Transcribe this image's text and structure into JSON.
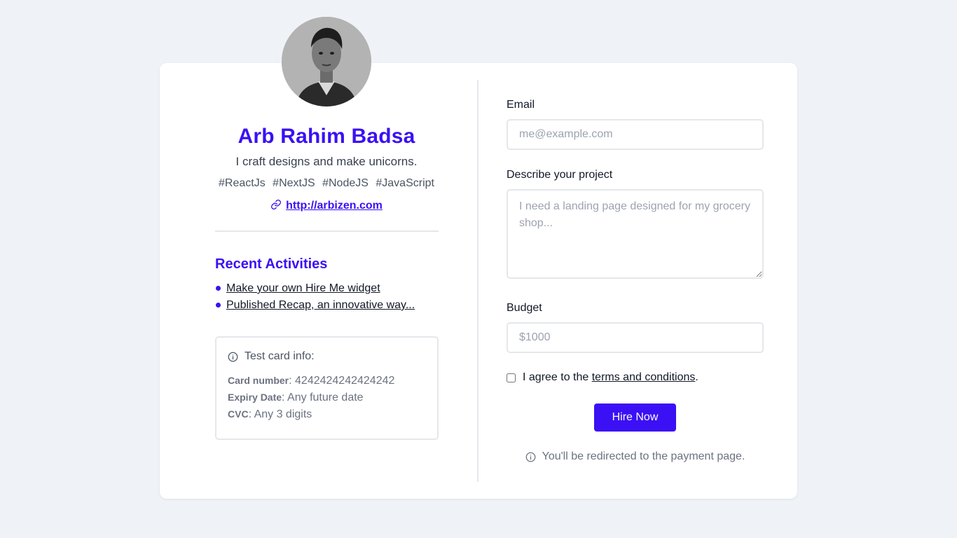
{
  "profile": {
    "name": "Arb Rahim Badsa",
    "tagline": "I craft designs and make unicorns.",
    "tags": [
      "#ReactJs",
      "#NextJS",
      "#NodeJS",
      "#JavaScript"
    ],
    "website": "http://arbizen.com",
    "avatar_icon": "profile-photo"
  },
  "recent": {
    "title": "Recent Activities",
    "items": [
      "Make your own Hire Me widget",
      "Published Recap, an innovative way..."
    ]
  },
  "test_card": {
    "heading": "Test card info:",
    "card_number_label": "Card number",
    "card_number_value": ": 4242424242424242",
    "expiry_label": "Expiry Date",
    "expiry_value": ": Any future date",
    "cvc_label": "CVC",
    "cvc_value": ": Any 3 digits"
  },
  "form": {
    "email_label": "Email",
    "email_placeholder": "me@example.com",
    "project_label": "Describe your project",
    "project_placeholder": "I need a landing page designed for my grocery shop...",
    "budget_label": "Budget",
    "budget_placeholder": "$1000",
    "agree_prefix": "I agree to the ",
    "agree_link": "terms and conditions",
    "agree_suffix": ".",
    "submit_label": "Hire Now",
    "redirect_note": "You'll be redirected to the payment page."
  },
  "colors": {
    "accent": "#3b10f4",
    "background": "#eff2f7",
    "card": "#ffffff",
    "border": "#e5e7eb"
  }
}
